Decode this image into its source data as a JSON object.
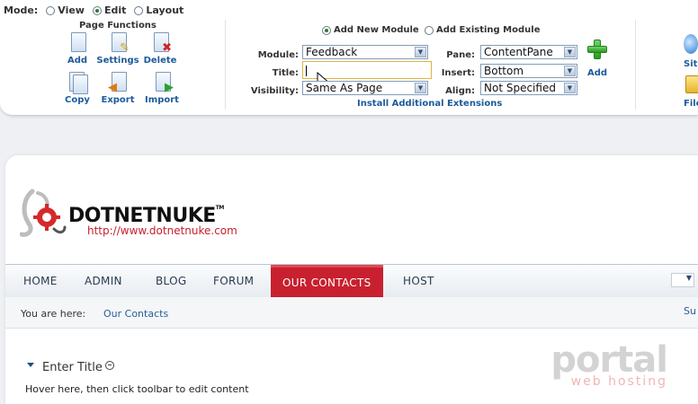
{
  "control_panel": {
    "mode_label": "Mode:",
    "modes": [
      {
        "label": "View",
        "selected": false
      },
      {
        "label": "Edit",
        "selected": true
      },
      {
        "label": "Layout",
        "selected": false
      }
    ],
    "page_functions_title": "Page Functions",
    "page_functions": [
      {
        "label": "Add",
        "icon": "add-page-icon"
      },
      {
        "label": "Settings",
        "icon": "settings-page-icon"
      },
      {
        "label": "Delete",
        "icon": "delete-page-icon"
      },
      {
        "label": "Copy",
        "icon": "copy-page-icon"
      },
      {
        "label": "Export",
        "icon": "export-page-icon"
      },
      {
        "label": "Import",
        "icon": "import-page-icon"
      }
    ],
    "add_new_module": "Add New Module",
    "add_existing_module": "Add Existing Module",
    "module_label": "Module:",
    "module_value": "Feedback",
    "title_label": "Title:",
    "title_value": "",
    "visibility_label": "Visibility:",
    "visibility_value": "Same As Page",
    "pane_label": "Pane:",
    "pane_value": "ContentPane",
    "insert_label": "Insert:",
    "insert_value": "Bottom",
    "align_label": "Align:",
    "align_value": "Not Specified",
    "add_label": "Add",
    "install_link": "Install Additional Extensions",
    "edge_top": "Sit",
    "edge_bottom": "File"
  },
  "site": {
    "brand": "DOTNETNUKE",
    "brand_tm": "TM",
    "url": "http://www.dotnetnuke.com",
    "nav": [
      "HOME",
      "ADMIN",
      "BLOG",
      "FORUM",
      "OUR CONTACTS",
      "HOST"
    ],
    "active_nav": "OUR CONTACTS",
    "breadcrumb_label": "You are here:",
    "breadcrumb_link": "Our Contacts",
    "breadcrumb_right": "Su",
    "module_title": "Enter Title",
    "module_body": "Hover here, then click toolbar to edit content"
  },
  "watermark": {
    "main": "portal",
    "sub": "web hosting"
  },
  "colors": {
    "accent_red": "#c8202e",
    "link_blue": "#1d5b9a",
    "add_green": "#2a9a22"
  }
}
